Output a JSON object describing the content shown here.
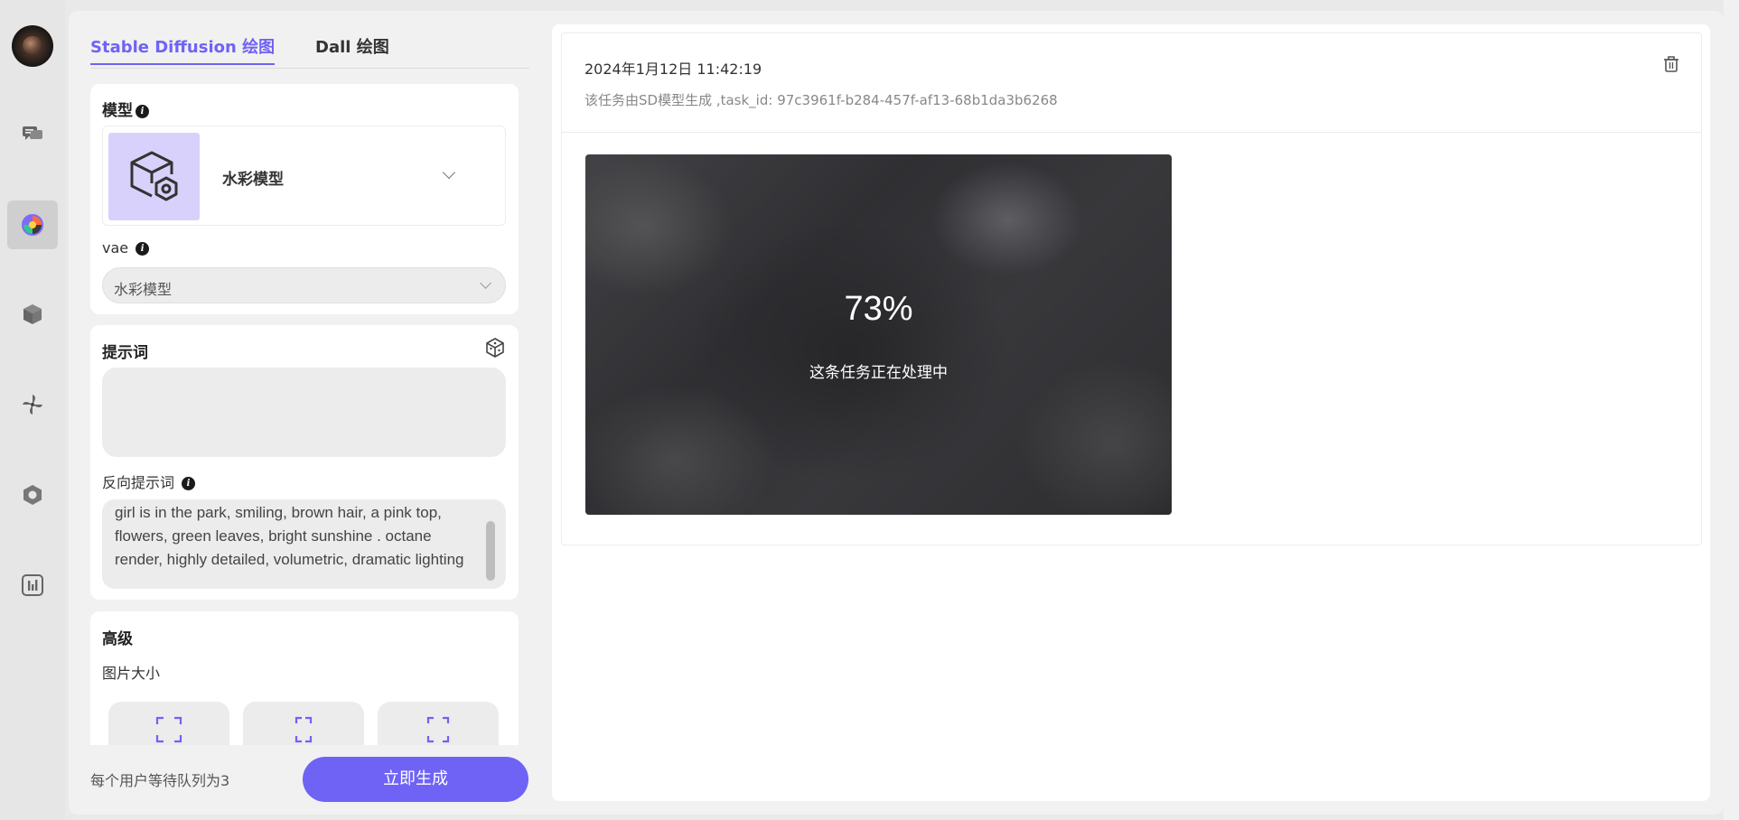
{
  "sidebar": {
    "items": [
      {
        "icon": "chat-icon"
      },
      {
        "icon": "palette-icon",
        "active": true
      },
      {
        "icon": "cube-icon"
      },
      {
        "icon": "pinwheel-icon"
      },
      {
        "icon": "hexagon-icon"
      },
      {
        "icon": "chart-icon"
      }
    ]
  },
  "tabs": [
    {
      "label": "Stable Diffusion 绘图",
      "active": true
    },
    {
      "label": "Dall 绘图",
      "active": false
    }
  ],
  "model_card": {
    "title": "模型",
    "model_name": "水彩模型",
    "vae_label": "vae",
    "vae_value": "水彩模型"
  },
  "prompt_card": {
    "title": "提示词",
    "prompt_value": "",
    "negative_label": "反向提示词",
    "negative_value": "girl is in the park, smiling, brown hair, a pink top, flowers, green leaves, bright sunshine . octane render, highly detailed, volumetric, dramatic lighting"
  },
  "advanced_card": {
    "title": "高级",
    "size_label": "图片大小"
  },
  "footer": {
    "queue_text": "每个用户等待队列为3",
    "generate_label": "立即生成"
  },
  "task": {
    "date": "2024年1月12日 11:42:19",
    "description": "该任务由SD模型生成 ,task_id: 97c3961f-b284-457f-af13-68b1da3b6268",
    "progress_text": "73%",
    "progress": 0.73,
    "status_text": "这条任务正在处理中"
  },
  "colors": {
    "accent": "#6f63f5",
    "model_thumb_bg": "#d8d1fb"
  }
}
